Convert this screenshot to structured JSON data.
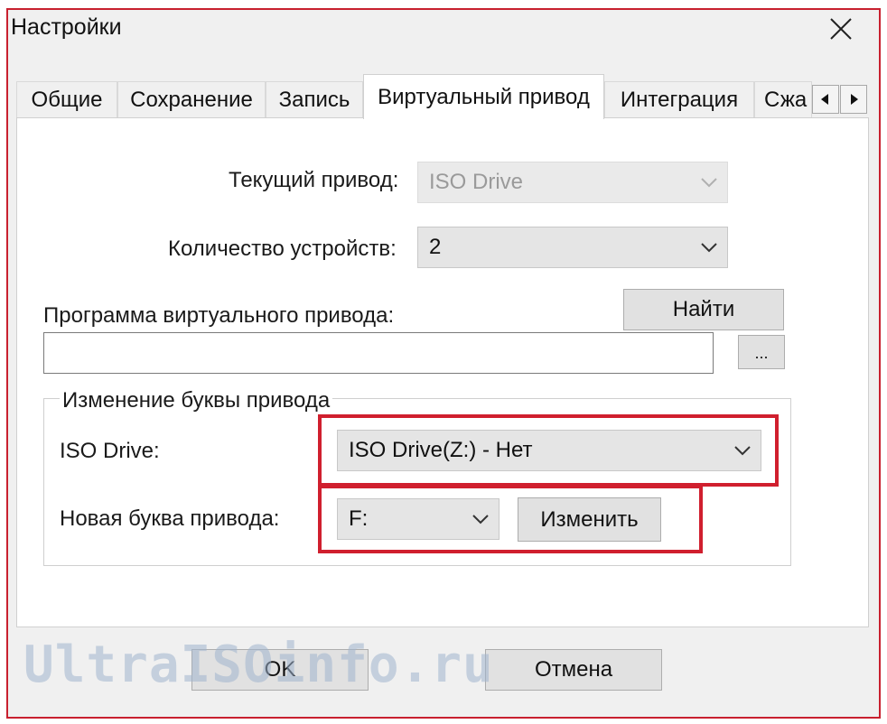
{
  "window": {
    "title": "Настройки",
    "close_icon": "close-icon"
  },
  "tabs": [
    {
      "label": "Общие"
    },
    {
      "label": "Сохранение"
    },
    {
      "label": "Запись"
    },
    {
      "label": "Виртуальный привод",
      "active": true
    },
    {
      "label": "Интеграция"
    },
    {
      "label": "Сжа"
    }
  ],
  "tab_scroll": {
    "left_icon": "triangle-left-icon",
    "right_icon": "triangle-right-icon"
  },
  "virtual_drive": {
    "current_drive_label": "Текущий привод:",
    "current_drive_value": "ISO Drive",
    "device_count_label": "Количество устройств:",
    "device_count_value": "2",
    "program_label": "Программа виртуального привода:",
    "find_button": "Найти",
    "program_path_value": "",
    "browse_button": "..."
  },
  "drive_letter_group": {
    "legend": "Изменение буквы привода",
    "drive_label": "ISO Drive:",
    "drive_value": "ISO Drive(Z:) - Нет",
    "new_letter_label": "Новая буква привода:",
    "new_letter_value": "F:",
    "change_button": "Изменить"
  },
  "footer": {
    "ok_button": "OK",
    "cancel_button": "Отмена"
  },
  "watermark": "UltraISOinfo.ru",
  "colors": {
    "highlight": "#d01f2e",
    "dialog_border": "#c8202f"
  }
}
